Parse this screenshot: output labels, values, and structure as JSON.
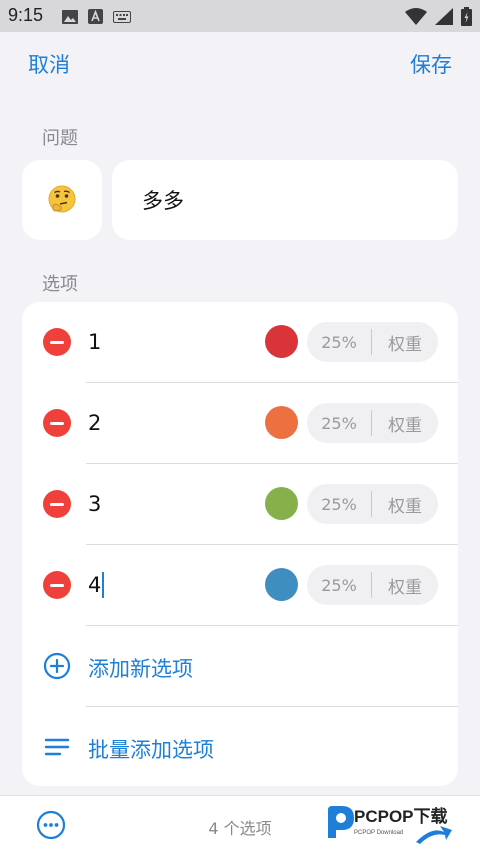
{
  "status_bar": {
    "time": "9:15"
  },
  "nav": {
    "cancel": "取消",
    "save": "保存"
  },
  "question": {
    "section_label": "问题",
    "emoji": "🤔",
    "text": "多多"
  },
  "options": {
    "section_label": "选项",
    "items": [
      {
        "text": "1",
        "color": "#d9343a",
        "percent": "25%",
        "weight_label": "权重"
      },
      {
        "text": "2",
        "color": "#ec7040",
        "percent": "25%",
        "weight_label": "权重"
      },
      {
        "text": "3",
        "color": "#85b04a",
        "percent": "25%",
        "weight_label": "权重"
      },
      {
        "text": "4",
        "color": "#3e8fc0",
        "percent": "25%",
        "weight_label": "权重"
      }
    ],
    "add_new": "添加新选项",
    "bulk_add": "批量添加选项"
  },
  "bottom_bar": {
    "count": "4 个选项"
  },
  "watermark": {
    "brand": "PCPOP下载",
    "sub": "PCPOP Download"
  },
  "colors": {
    "accent": "#1e7fd8",
    "danger": "#f0403b"
  }
}
